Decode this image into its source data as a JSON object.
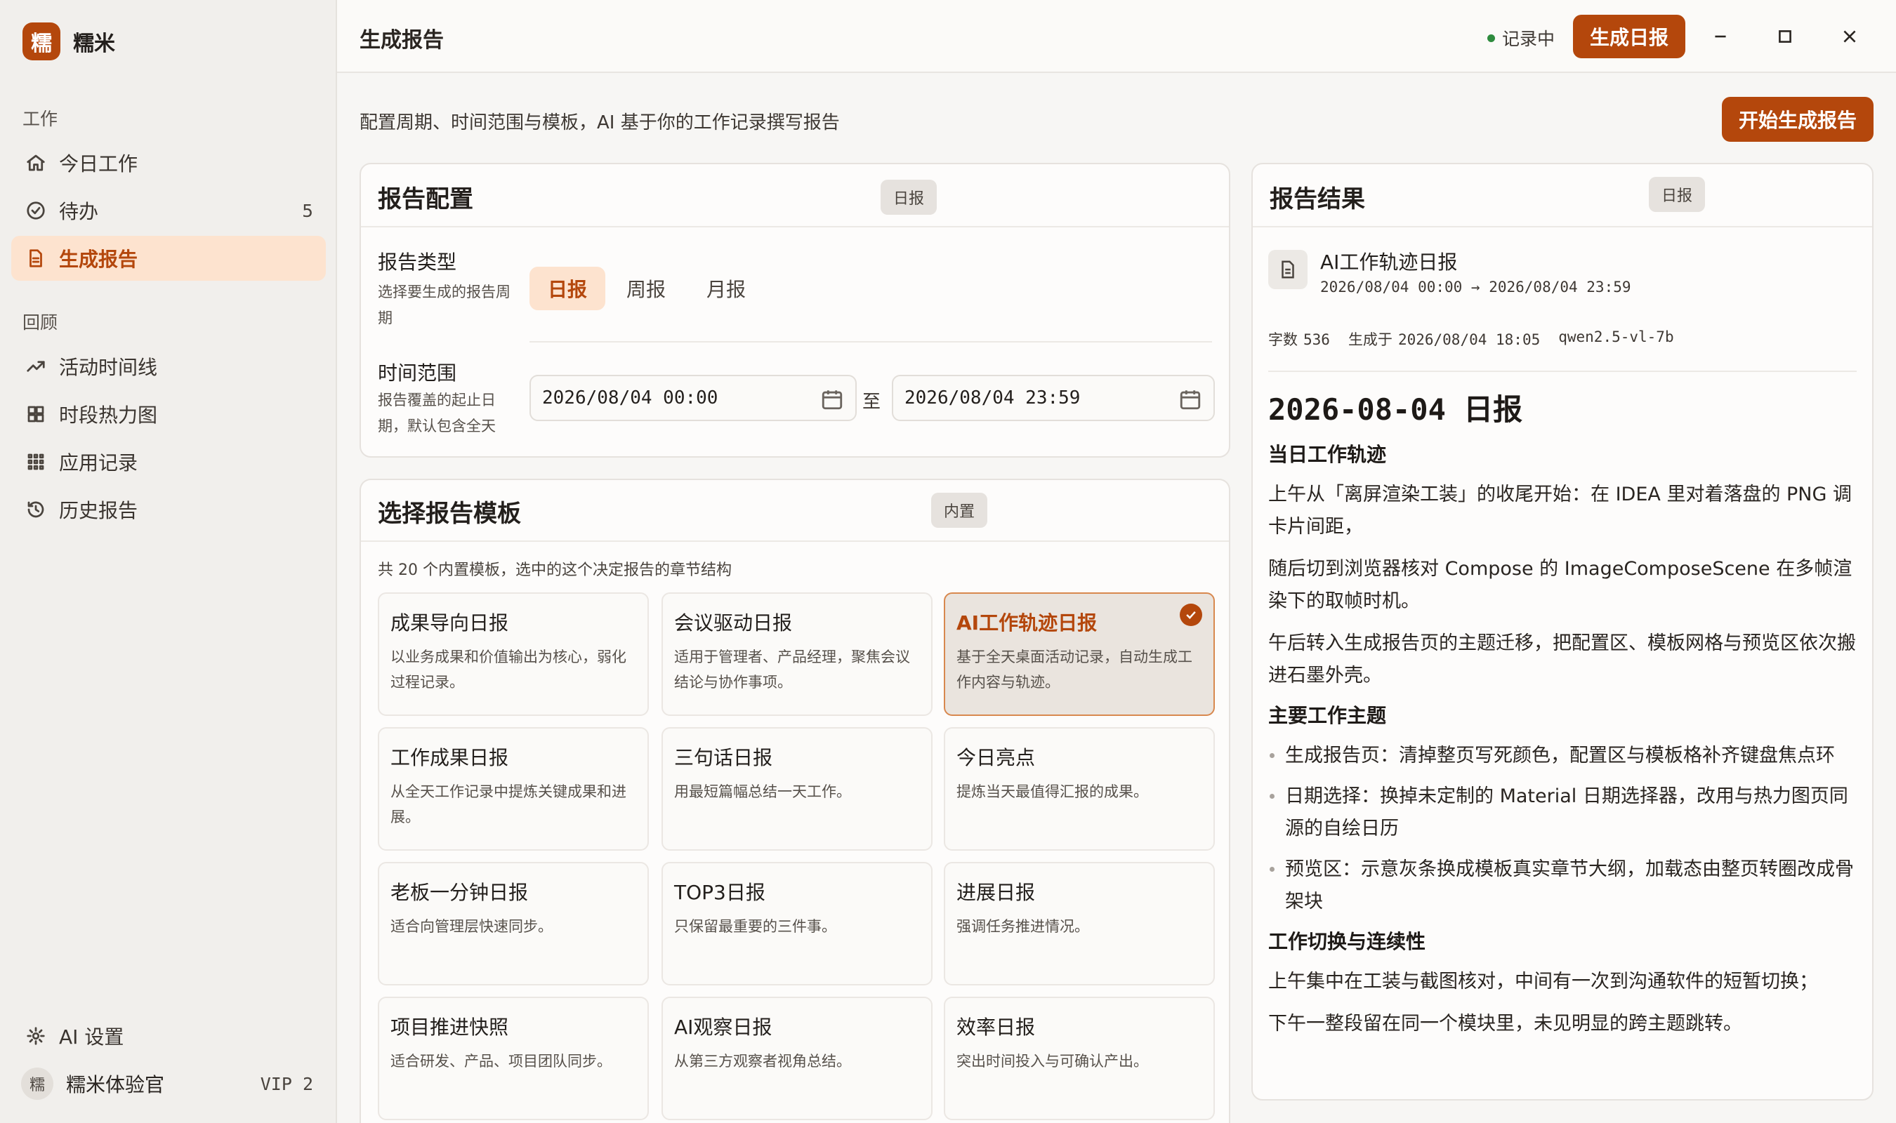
{
  "brand": {
    "logo_char": "糯",
    "name": "糯米"
  },
  "sidebar": {
    "section_work": "工作",
    "section_review": "回顾",
    "items": [
      {
        "label": "今日工作",
        "icon": "home-icon"
      },
      {
        "label": "待办",
        "icon": "check-circle-icon",
        "count": "5"
      },
      {
        "label": "生成报告",
        "icon": "document-icon",
        "active": true
      },
      {
        "label": "活动时间线",
        "icon": "trend-line-icon"
      },
      {
        "label": "时段热力图",
        "icon": "grid-icon"
      },
      {
        "label": "应用记录",
        "icon": "apps-icon"
      },
      {
        "label": "历史报告",
        "icon": "history-icon"
      }
    ],
    "settings_label": "AI 设置",
    "user": {
      "avatar_char": "糯",
      "name": "糯米体验官",
      "vip": "VIP 2"
    }
  },
  "header": {
    "title": "生成报告",
    "recording": "记录中",
    "daily_button": "生成日报"
  },
  "main": {
    "subtitle": "配置周期、时间范围与模板，AI 基于你的工作记录撰写报告",
    "start_button": "开始生成报告"
  },
  "config": {
    "title": "报告配置",
    "badge": "日报",
    "type_label": "报告类型",
    "type_help": "选择要生成的报告周期",
    "types": [
      "日报",
      "周报",
      "月报"
    ],
    "range_label": "时间范围",
    "range_help": "报告覆盖的起止日期，默认包含全天",
    "start": "2026/08/04 00:00",
    "end": "2026/08/04 23:59",
    "sep": "至"
  },
  "templates": {
    "title": "选择报告模板",
    "badge": "内置",
    "count_text": "共 20 个内置模板，选中的这个决定报告的章节结构",
    "items": [
      {
        "name": "成果导向日报",
        "desc": "以业务成果和价值输出为核心，弱化过程记录。"
      },
      {
        "name": "会议驱动日报",
        "desc": "适用于管理者、产品经理，聚焦会议结论与协作事项。"
      },
      {
        "name": "AI工作轨迹日报",
        "desc": "基于全天桌面活动记录，自动生成工作内容与轨迹。",
        "selected": true
      },
      {
        "name": "工作成果日报",
        "desc": "从全天工作记录中提炼关键成果和进展。"
      },
      {
        "name": "三句话日报",
        "desc": "用最短篇幅总结一天工作。"
      },
      {
        "name": "今日亮点",
        "desc": "提炼当天最值得汇报的成果。"
      },
      {
        "name": "老板一分钟日报",
        "desc": "适合向管理层快速同步。"
      },
      {
        "name": "TOP3日报",
        "desc": "只保留最重要的三件事。"
      },
      {
        "name": "进展日报",
        "desc": "强调任务推进情况。"
      },
      {
        "name": "项目推进快照",
        "desc": "适合研发、产品、项目团队同步。"
      },
      {
        "name": "AI观察日报",
        "desc": "从第三方观察者视角总结。"
      },
      {
        "name": "效率日报",
        "desc": "突出时间投入与可确认产出。"
      }
    ]
  },
  "result": {
    "title": "报告结果",
    "badge": "日报",
    "name": "AI工作轨迹日报",
    "range": "2026/08/04 00:00 → 2026/08/04 23:59",
    "meta_words_label": "字数",
    "meta_words": "536",
    "meta_time_label": "生成于",
    "meta_time": "2026/08/04 18:05",
    "meta_model": "qwen2.5-vl-7b",
    "doc": {
      "h1": "2026-08-04 日报",
      "s1_title": "当日工作轨迹",
      "s1_p1": "上午从「离屏渲染工装」的收尾开始：在 IDEA 里对着落盘的 PNG 调卡片间距，",
      "s1_p2": "随后切到浏览器核对 Compose 的 ImageComposeScene 在多帧渲染下的取帧时机。",
      "s1_p3": "午后转入生成报告页的主题迁移，把配置区、模板网格与预览区依次搬进石墨外壳。",
      "s2_title": "主要工作主题",
      "s2_b1": "生成报告页：清掉整页写死颜色，配置区与模板格补齐键盘焦点环",
      "s2_b2": "日期选择：换掉未定制的 Material 日期选择器，改用与热力图页同源的自绘日历",
      "s2_b3": "预览区：示意灰条换成模板真实章节大纲，加载态由整页转圈改成骨架块",
      "s3_title": "工作切换与连续性",
      "s3_p1": "上午集中在工装与截图核对，中间有一次到沟通软件的短暂切换；",
      "s3_p2": "下午一整段留在同一个模块里，未见明显的跨主题跳转。"
    }
  },
  "colors": {
    "accent": "#b4470c",
    "accent_soft": "#fde3cf",
    "recording": "#2e8b3e"
  }
}
